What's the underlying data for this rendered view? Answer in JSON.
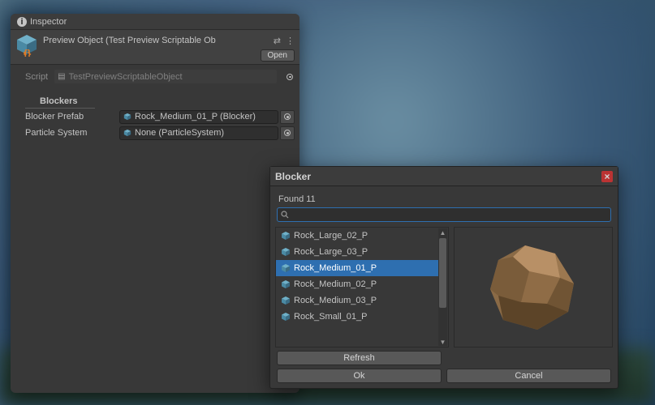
{
  "inspector": {
    "tab_title": "Inspector",
    "object_name": "Preview Object (Test Preview Scriptable Ob",
    "open_label": "Open",
    "script_label": "Script",
    "script_value": "TestPreviewScriptableObject",
    "section": "Blockers",
    "rows": [
      {
        "label": "Blocker Prefab",
        "value": "Rock_Medium_01_P (Blocker)"
      },
      {
        "label": "Particle System",
        "value": "None (ParticleSystem)"
      }
    ]
  },
  "picker": {
    "title": "Blocker",
    "found_label": "Found 11",
    "search_value": "",
    "items": [
      {
        "name": "Rock_Large_02_P",
        "selected": false
      },
      {
        "name": "Rock_Large_03_P",
        "selected": false
      },
      {
        "name": "Rock_Medium_01_P",
        "selected": true
      },
      {
        "name": "Rock_Medium_02_P",
        "selected": false
      },
      {
        "name": "Rock_Medium_03_P",
        "selected": false
      },
      {
        "name": "Rock_Small_01_P",
        "selected": false
      }
    ],
    "refresh_label": "Refresh",
    "ok_label": "Ok",
    "cancel_label": "Cancel"
  }
}
